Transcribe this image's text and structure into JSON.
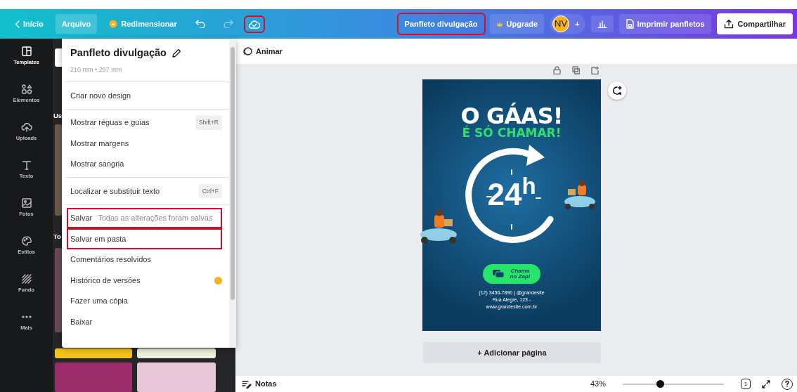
{
  "topbar": {
    "back": {
      "label": "Início"
    },
    "file_menu": {
      "label": "Arquivo",
      "selected": true
    },
    "resize": {
      "label": "Redimensionar"
    },
    "cloud_highlighted": true,
    "title_button": {
      "label": "Panfleto divulgação",
      "highlighted": true
    },
    "upgrade": {
      "label": "Upgrade"
    },
    "avatar": {
      "initials": "NV"
    },
    "add_member": {
      "label": "+"
    },
    "print": {
      "label": "Imprimir panfletos"
    },
    "share": {
      "label": "Compartilhar"
    }
  },
  "sidebar": {
    "items": [
      {
        "label": "Templates",
        "selected": true
      },
      {
        "label": "Elementos",
        "selected": false
      },
      {
        "label": "Uploads",
        "selected": false
      },
      {
        "label": "Texto",
        "selected": false
      },
      {
        "label": "Fotos",
        "selected": false
      },
      {
        "label": "Estilos",
        "selected": false
      },
      {
        "label": "Fundo",
        "selected": false
      },
      {
        "label": "Mais",
        "selected": false
      }
    ]
  },
  "panel": {
    "headings": [
      "Us",
      "To"
    ]
  },
  "file_menu": {
    "title": "Panfleto divulgação",
    "size": "210 mm • 297 mm",
    "sections": [
      [
        {
          "label": "Criar novo design",
          "highlighted": false
        }
      ],
      [
        {
          "label": "Mostrar réguas e guias",
          "shortcut": "Shift+R",
          "highlighted": false
        },
        {
          "label": "Mostrar margens",
          "highlighted": false
        },
        {
          "label": "Mostrar sangria",
          "highlighted": false
        }
      ],
      [
        {
          "label": "Localizar e substituir texto",
          "shortcut": "Ctrl+F",
          "highlighted": false
        }
      ],
      [
        {
          "label": "Salvar",
          "note": "Todas as alterações foram salvas",
          "highlighted": true
        },
        {
          "label": "Salvar em pasta",
          "highlighted": true
        },
        {
          "label": "Comentários resolvidos",
          "highlighted": false
        },
        {
          "label": "Histórico de versões",
          "premium": true,
          "highlighted": false
        },
        {
          "label": "Fazer uma cópia",
          "highlighted": false
        },
        {
          "label": "Baixar",
          "highlighted": false
        }
      ]
    ]
  },
  "canvas_toolbar": {
    "animate": "Animar"
  },
  "flyer": {
    "headline": "O GÁAS!",
    "subhead": "É SÓ CHAMAR!",
    "hours": "24$^{h}$",
    "cta": "Chama no Zap!",
    "contact": [
      "(12) 3456-7890 | @grandesite",
      "Rua Alegre, 123 -",
      "www.grandesite.com.br"
    ]
  },
  "add_page": "+ Adicionar página",
  "footer": {
    "notes": "Notas",
    "zoom": "43%",
    "zoom_slider": {
      "level": 0.37
    },
    "page_count": "1"
  }
}
